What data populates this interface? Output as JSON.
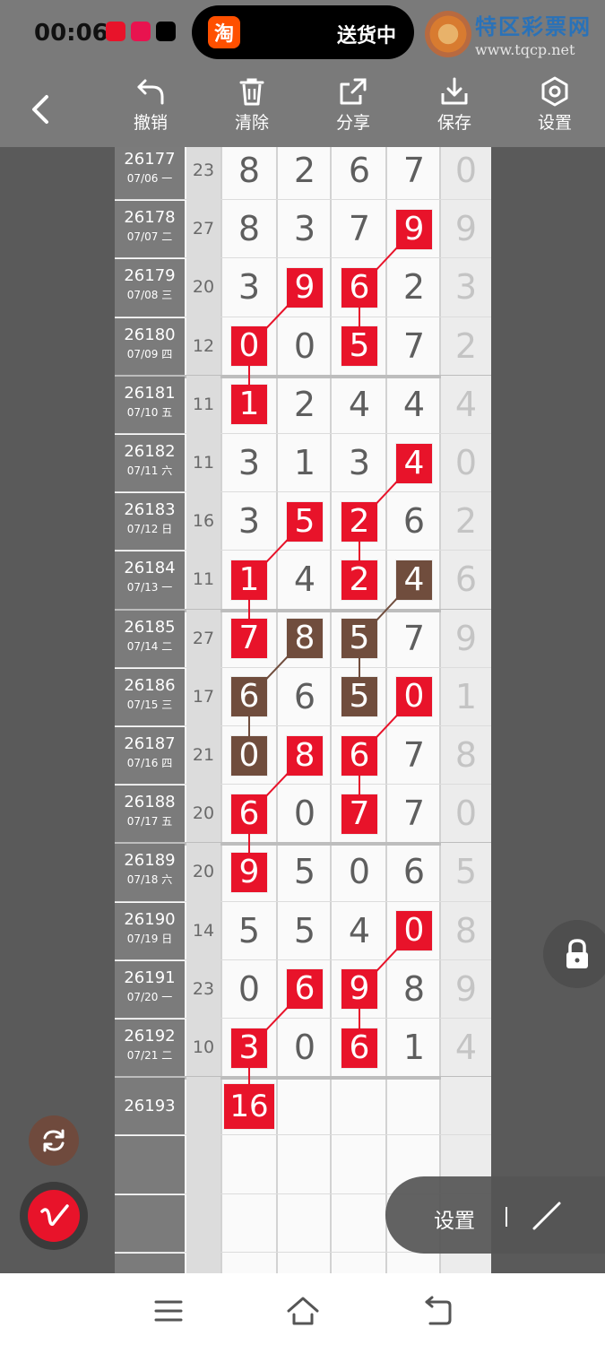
{
  "status_bar": {
    "time": "00:06",
    "pill_icon": "淘",
    "pill_text": "送货中",
    "watermark_title": "特区彩票网",
    "watermark_url": "www.tqcp.net",
    "colors": {
      "taobao": "#ff5000",
      "app_red": "#e8132a",
      "app_pink": "#e8134f",
      "tiktok": "#000000"
    }
  },
  "toolbar": {
    "back_icon": "chevron-left-icon",
    "tools": [
      {
        "label": "撤销",
        "icon": "undo-icon"
      },
      {
        "label": "清除",
        "icon": "trash-icon"
      },
      {
        "label": "分享",
        "icon": "share-icon"
      },
      {
        "label": "保存",
        "icon": "download-icon"
      },
      {
        "label": "设置",
        "icon": "hexagon-gear-icon"
      }
    ]
  },
  "draws": [
    {
      "issue": "26177",
      "date": "07/06 一",
      "sum": "23",
      "digits": [
        "8",
        "2",
        "6",
        "7"
      ],
      "last": "0"
    },
    {
      "issue": "26178",
      "date": "07/07 二",
      "sum": "27",
      "digits": [
        "8",
        "3",
        "7",
        "9"
      ],
      "last": "9"
    },
    {
      "issue": "26179",
      "date": "07/08 三",
      "sum": "20",
      "digits": [
        "3",
        "9",
        "6",
        "2"
      ],
      "last": "3"
    },
    {
      "issue": "26180",
      "date": "07/09 四",
      "sum": "12",
      "digits": [
        "0",
        "0",
        "5",
        "7"
      ],
      "last": "2"
    },
    {
      "issue": "26181",
      "date": "07/10 五",
      "sum": "11",
      "digits": [
        "1",
        "2",
        "4",
        "4"
      ],
      "last": "4"
    },
    {
      "issue": "26182",
      "date": "07/11 六",
      "sum": "11",
      "digits": [
        "3",
        "1",
        "3",
        "4"
      ],
      "last": "0"
    },
    {
      "issue": "26183",
      "date": "07/12 日",
      "sum": "16",
      "digits": [
        "3",
        "5",
        "2",
        "6"
      ],
      "last": "2"
    },
    {
      "issue": "26184",
      "date": "07/13 一",
      "sum": "11",
      "digits": [
        "1",
        "4",
        "2",
        "4"
      ],
      "last": "6"
    },
    {
      "issue": "26185",
      "date": "07/14 二",
      "sum": "27",
      "digits": [
        "7",
        "8",
        "5",
        "7"
      ],
      "last": "9"
    },
    {
      "issue": "26186",
      "date": "07/15 三",
      "sum": "17",
      "digits": [
        "6",
        "6",
        "5",
        "0"
      ],
      "last": "1"
    },
    {
      "issue": "26187",
      "date": "07/16 四",
      "sum": "21",
      "digits": [
        "0",
        "8",
        "6",
        "7"
      ],
      "last": "8"
    },
    {
      "issue": "26188",
      "date": "07/17 五",
      "sum": "20",
      "digits": [
        "6",
        "0",
        "7",
        "7"
      ],
      "last": "0"
    },
    {
      "issue": "26189",
      "date": "07/18 六",
      "sum": "20",
      "digits": [
        "9",
        "5",
        "0",
        "6"
      ],
      "last": "5"
    },
    {
      "issue": "26190",
      "date": "07/19 日",
      "sum": "14",
      "digits": [
        "5",
        "5",
        "4",
        "0"
      ],
      "last": "8"
    },
    {
      "issue": "26191",
      "date": "07/20 一",
      "sum": "23",
      "digits": [
        "0",
        "6",
        "9",
        "8"
      ],
      "last": "9"
    },
    {
      "issue": "26192",
      "date": "07/21 二",
      "sum": "10",
      "digits": [
        "3",
        "0",
        "6",
        "1"
      ],
      "last": "4"
    }
  ],
  "pending": {
    "issue": "26193",
    "value": "16"
  },
  "highlights": [
    {
      "row": 1,
      "col": 3,
      "color": "red"
    },
    {
      "row": 2,
      "col": 1,
      "color": "red"
    },
    {
      "row": 2,
      "col": 2,
      "color": "red"
    },
    {
      "row": 3,
      "col": 0,
      "color": "red"
    },
    {
      "row": 3,
      "col": 2,
      "color": "red"
    },
    {
      "row": 4,
      "col": 0,
      "color": "red"
    },
    {
      "row": 5,
      "col": 3,
      "color": "red"
    },
    {
      "row": 6,
      "col": 1,
      "color": "red"
    },
    {
      "row": 6,
      "col": 2,
      "color": "red"
    },
    {
      "row": 7,
      "col": 0,
      "color": "red"
    },
    {
      "row": 7,
      "col": 2,
      "color": "red"
    },
    {
      "row": 7,
      "col": 3,
      "color": "brown"
    },
    {
      "row": 8,
      "col": 0,
      "color": "red"
    },
    {
      "row": 8,
      "col": 1,
      "color": "brown"
    },
    {
      "row": 8,
      "col": 2,
      "color": "brown"
    },
    {
      "row": 9,
      "col": 0,
      "color": "brown"
    },
    {
      "row": 9,
      "col": 2,
      "color": "brown"
    },
    {
      "row": 9,
      "col": 3,
      "color": "red"
    },
    {
      "row": 10,
      "col": 0,
      "color": "brown"
    },
    {
      "row": 10,
      "col": 1,
      "color": "red"
    },
    {
      "row": 10,
      "col": 2,
      "color": "red"
    },
    {
      "row": 11,
      "col": 0,
      "color": "red"
    },
    {
      "row": 11,
      "col": 2,
      "color": "red"
    },
    {
      "row": 12,
      "col": 0,
      "color": "red"
    },
    {
      "row": 13,
      "col": 3,
      "color": "red"
    },
    {
      "row": 14,
      "col": 1,
      "color": "red"
    },
    {
      "row": 14,
      "col": 2,
      "color": "red"
    },
    {
      "row": 15,
      "col": 0,
      "color": "red"
    },
    {
      "row": 15,
      "col": 2,
      "color": "red"
    }
  ],
  "connectors": [
    {
      "from": [
        1,
        3
      ],
      "to": [
        2,
        2
      ],
      "color": "red"
    },
    {
      "from": [
        2,
        2
      ],
      "to": [
        3,
        2
      ],
      "color": "red"
    },
    {
      "from": [
        2,
        1
      ],
      "to": [
        3,
        0
      ],
      "color": "red"
    },
    {
      "from": [
        3,
        0
      ],
      "to": [
        4,
        0
      ],
      "color": "red"
    },
    {
      "from": [
        5,
        3
      ],
      "to": [
        6,
        2
      ],
      "color": "red"
    },
    {
      "from": [
        6,
        2
      ],
      "to": [
        7,
        2
      ],
      "color": "red"
    },
    {
      "from": [
        6,
        1
      ],
      "to": [
        7,
        0
      ],
      "color": "red"
    },
    {
      "from": [
        7,
        0
      ],
      "to": [
        8,
        0
      ],
      "color": "red"
    },
    {
      "from": [
        7,
        3
      ],
      "to": [
        8,
        2
      ],
      "color": "brown"
    },
    {
      "from": [
        8,
        2
      ],
      "to": [
        9,
        2
      ],
      "color": "brown"
    },
    {
      "from": [
        8,
        1
      ],
      "to": [
        9,
        0
      ],
      "color": "brown"
    },
    {
      "from": [
        9,
        0
      ],
      "to": [
        10,
        0
      ],
      "color": "brown"
    },
    {
      "from": [
        9,
        3
      ],
      "to": [
        10,
        2
      ],
      "color": "red"
    },
    {
      "from": [
        10,
        2
      ],
      "to": [
        11,
        2
      ],
      "color": "red"
    },
    {
      "from": [
        10,
        1
      ],
      "to": [
        11,
        0
      ],
      "color": "red"
    },
    {
      "from": [
        11,
        0
      ],
      "to": [
        12,
        0
      ],
      "color": "red"
    },
    {
      "from": [
        13,
        3
      ],
      "to": [
        14,
        2
      ],
      "color": "red"
    },
    {
      "from": [
        14,
        2
      ],
      "to": [
        15,
        2
      ],
      "color": "red"
    },
    {
      "from": [
        14,
        1
      ],
      "to": [
        15,
        0
      ],
      "color": "red"
    },
    {
      "from": [
        15,
        0
      ],
      "to": [
        16,
        0
      ],
      "color": "red"
    }
  ],
  "colors": {
    "red": "#e8132a",
    "brown": "#704d3d"
  },
  "floating": {
    "lock_icon": "lock-icon",
    "refresh_icon": "refresh-icon",
    "pen_icon": "pen-icon",
    "settings_label": "设置",
    "line_tool_icon": "line-tool-icon"
  },
  "nav": {
    "menu_icon": "menu-icon",
    "home_icon": "home-icon",
    "back_icon": "back-icon"
  }
}
